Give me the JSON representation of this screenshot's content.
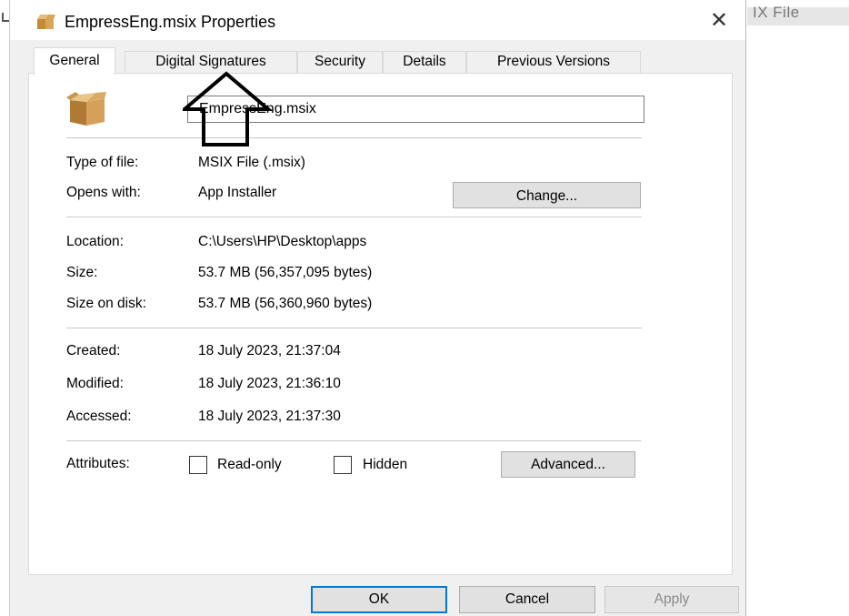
{
  "background": {
    "right_text": "IX File"
  },
  "dialog": {
    "title": "EmpressEng.msix Properties",
    "close_glyph": "✕"
  },
  "tabs": [
    {
      "label": "General",
      "active": true
    },
    {
      "label": "Digital Signatures",
      "active": false
    },
    {
      "label": "Security",
      "active": false
    },
    {
      "label": "Details",
      "active": false
    },
    {
      "label": "Previous Versions",
      "active": false
    }
  ],
  "general": {
    "file_name": "EmpressEng.msix",
    "type_label": "Type of file:",
    "type_value": "MSIX File (.msix)",
    "opens_label": "Opens with:",
    "opens_value": "App Installer",
    "change_button": "Change...",
    "location_label": "Location:",
    "location_value": "C:\\Users\\HP\\Desktop\\apps",
    "size_label": "Size:",
    "size_value": "53.7 MB (56,357,095 bytes)",
    "size_disk_label": "Size on disk:",
    "size_disk_value": "53.7 MB (56,360,960 bytes)",
    "created_label": "Created:",
    "created_value": "18 July 2023, 21:37:04",
    "modified_label": "Modified:",
    "modified_value": "18 July 2023, 21:36:10",
    "accessed_label": "Accessed:",
    "accessed_value": "18 July 2023, 21:37:30",
    "attributes_label": "Attributes:",
    "readonly_label": "Read-only",
    "readonly_checked": false,
    "hidden_label": "Hidden",
    "hidden_checked": false,
    "advanced_button": "Advanced..."
  },
  "footer": {
    "ok": "OK",
    "cancel": "Cancel",
    "apply": "Apply"
  },
  "icons": {
    "file_icon": "package-box-icon",
    "annotation": "up-arrow-annotation-icon"
  },
  "colors": {
    "accent": "#0078d7",
    "dialog_bg": "#f0f0f0",
    "panel_bg": "#ffffff"
  }
}
